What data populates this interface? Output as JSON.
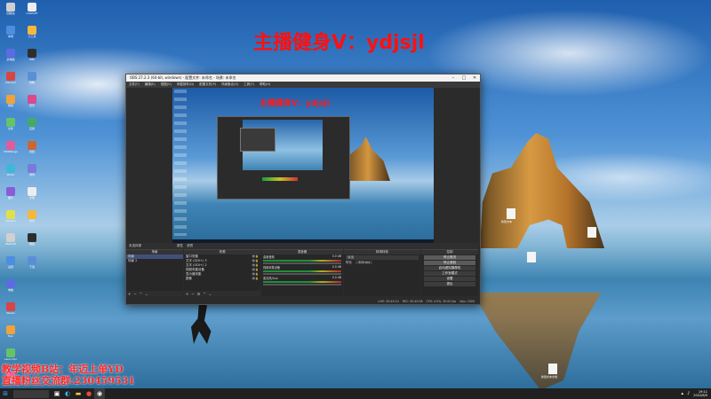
{
  "desktop": {
    "watermark_top": "主播健身V：ydjsjl",
    "watermark_bottom_line1": "教学视频B站：年迈上单YD",
    "watermark_bottom_line2": "直播粉丝交流群:230459531",
    "left_icons_col1": [
      "回收站",
      "本地",
      "此电脑",
      "Discord",
      "网易",
      "文件",
      "MP3Merge",
      "Photo",
      "图片",
      "Lenovo",
      "WeChat",
      "设置",
      "电脑",
      "Steam",
      "Epic",
      "Launcher",
      "文件夹"
    ],
    "left_icons_col2": [
      "ChatGPT",
      "小工具",
      "OBS",
      "剪映",
      "音乐",
      "应用",
      "视频",
      "游戏",
      "文档",
      "共享",
      "网盘",
      "下载"
    ],
    "file_labels": [
      "新建文本",
      "新建文本文档"
    ]
  },
  "obs": {
    "title": "OBS 27.2.3 (64-bit, windows) - 配置文件: 未命名 - 场景: 未命名",
    "menu": [
      "文件(F)",
      "编辑(E)",
      "视图(V)",
      "停靠部件(D)",
      "配置文件(P)",
      "场景集合(S)",
      "工具(T)",
      "帮助(H)"
    ],
    "preview_watermark": "主播健身V：ydjsjl",
    "scene_bar_label": "未选择源",
    "scene_bar_props": "属性",
    "scene_bar_filters": "滤镜",
    "scenes_header": "场景",
    "scenes": [
      "场景",
      "场景 2"
    ],
    "sources_header": "来源",
    "sources": [
      "窗口采集",
      "文字 (GDI+) 3",
      "文字 (GDI+) 2",
      "视频采集设备",
      "显示器采集",
      "图像"
    ],
    "mixer_header": "混音器",
    "mixer": [
      {
        "name": "桌面音频",
        "db": "0.0 dB"
      },
      {
        "name": "视频采集设备",
        "db": "0.0 dB"
      },
      {
        "name": "麦克风/Aux",
        "db": "0.0 dB"
      }
    ],
    "transitions_header": "转场特效",
    "transition_type": "淡出",
    "transition_duration_label": "时长",
    "transition_duration": "300 ms",
    "controls_header": "控制",
    "controls": [
      "停止推流",
      "停止录制",
      "启动虚拟摄像机",
      "工作室模式",
      "设置",
      "退出"
    ],
    "status": [
      "LIVE: 00:45:10",
      "REC: 00:45:08",
      "CPU: 4.5%, 30.00 fps",
      "kb/s: 2500"
    ]
  },
  "taskbar": {
    "time": "19:11",
    "date": "2022/8/9"
  },
  "colors": {
    "obs_bg": "#2b2b2b",
    "watermark": "#ff1010",
    "taskbar": "#202020"
  }
}
